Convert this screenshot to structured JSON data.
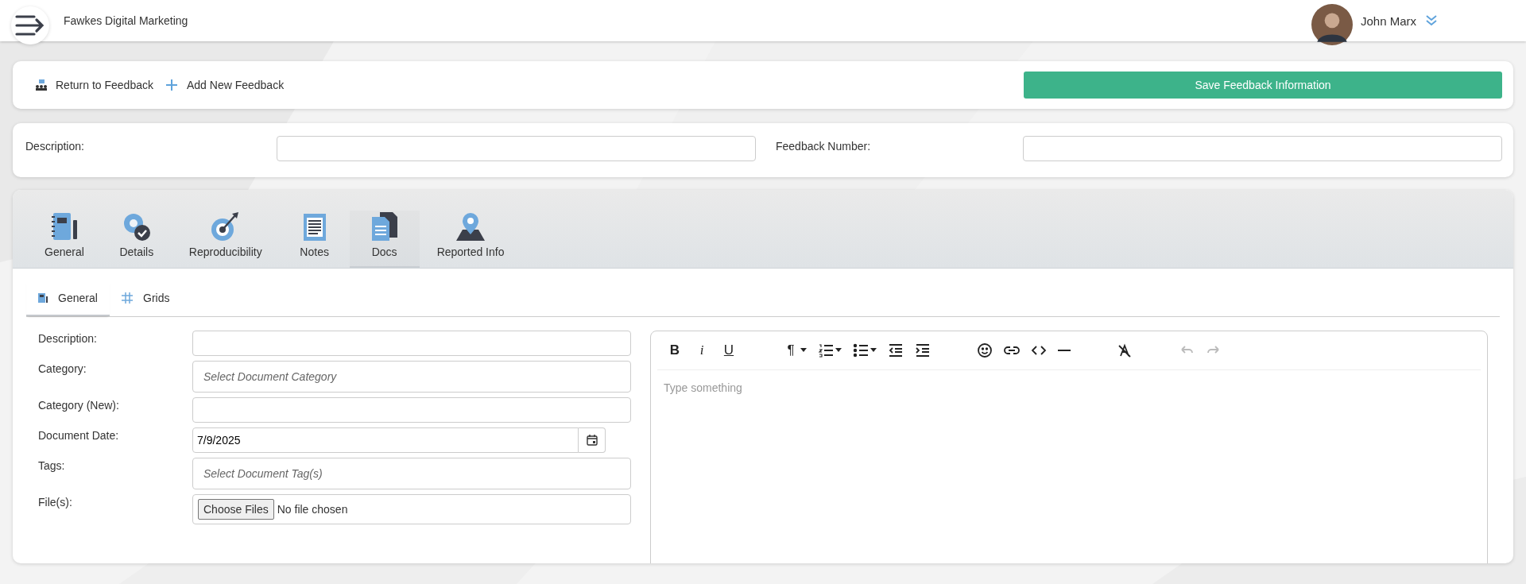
{
  "header": {
    "company": "Fawkes Digital Marketing",
    "user": "John Marx"
  },
  "actions": {
    "links": [
      {
        "kind": "return",
        "label": "Return to Feedback"
      },
      {
        "kind": "add",
        "label": "Add New Feedback"
      }
    ],
    "save": "Save Feedback Information"
  },
  "summary": [
    {
      "label": "Description:"
    },
    {
      "label": "Feedback Number:"
    }
  ],
  "tabs": [
    {
      "kind": "general",
      "label": "General",
      "selected": false
    },
    {
      "kind": "details",
      "label": "Details",
      "selected": false
    },
    {
      "kind": "target",
      "label": "Reproducibility",
      "selected": false
    },
    {
      "kind": "notes",
      "label": "Notes",
      "selected": false
    },
    {
      "kind": "docs",
      "label": "Docs",
      "selected": true
    },
    {
      "kind": "map",
      "label": "Reported Info",
      "selected": false
    }
  ],
  "subtabs": [
    {
      "kind": "general",
      "label": "General",
      "selected": true
    },
    {
      "kind": "grid",
      "label": "Grids",
      "selected": false
    }
  ],
  "form": [
    {
      "kind": "text",
      "label": "Description:"
    },
    {
      "kind": "select",
      "label": "Category:",
      "placeholder": "Select Document Category"
    },
    {
      "kind": "text",
      "label": "Category (New):"
    },
    {
      "kind": "date",
      "label": "Document Date:",
      "value": "7/9/2025"
    },
    {
      "kind": "select",
      "label": "Tags:",
      "placeholder": "Select Document Tag(s)"
    },
    {
      "kind": "file",
      "label": "File(s):",
      "button": "Choose Files",
      "status": "No file chosen"
    }
  ],
  "editor": {
    "placeholder": "Type something",
    "toolbar": [
      {
        "kind": "bold",
        "label": "B",
        "disabled": false
      },
      {
        "kind": "italic",
        "label": "i",
        "disabled": false
      },
      {
        "kind": "underline",
        "label": "U",
        "disabled": false
      },
      {
        "kind": "gap"
      },
      {
        "kind": "paragraph",
        "label": "¶",
        "disabled": false
      },
      {
        "kind": "ordered",
        "disabled": false
      },
      {
        "kind": "bullets",
        "disabled": false
      },
      {
        "kind": "outdent",
        "disabled": false
      },
      {
        "kind": "indent",
        "disabled": false
      },
      {
        "kind": "gap"
      },
      {
        "kind": "emoji",
        "disabled": false
      },
      {
        "kind": "link",
        "disabled": false
      },
      {
        "kind": "code",
        "disabled": false
      },
      {
        "kind": "rule",
        "disabled": false
      },
      {
        "kind": "gap"
      },
      {
        "kind": "clear",
        "disabled": false
      },
      {
        "kind": "gap"
      },
      {
        "kind": "undo",
        "disabled": true
      },
      {
        "kind": "redo",
        "disabled": true
      }
    ]
  }
}
